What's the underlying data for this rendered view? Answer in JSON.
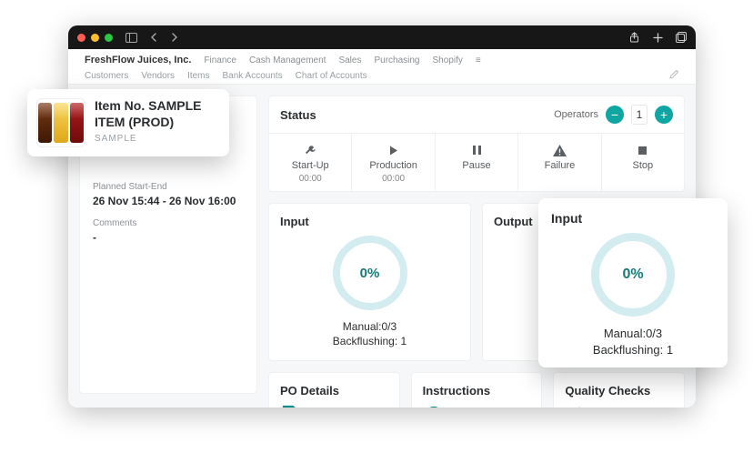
{
  "nav": {
    "brand": "FreshFlow Juices, Inc.",
    "primary": [
      "Finance",
      "Cash Management",
      "Sales",
      "Purchasing",
      "Shopify"
    ],
    "secondary": [
      "Customers",
      "Vendors",
      "Items",
      "Bank Accounts",
      "Chart of Accounts"
    ]
  },
  "item": {
    "title": "Item No. SAMPLE ITEM (PROD)",
    "code": "SAMPLE"
  },
  "plan": {
    "label": "Planned Start-End",
    "value": "26 Nov 15:44 - 26 Nov 16:00",
    "comments_label": "Comments",
    "comments_value": "-"
  },
  "status": {
    "title": "Status",
    "operators_label": "Operators",
    "operators_count": "1",
    "buttons": [
      {
        "label": "Start-Up",
        "time": "00:00"
      },
      {
        "label": "Production",
        "time": "00:00"
      },
      {
        "label": "Pause",
        "time": ""
      },
      {
        "label": "Failure",
        "time": ""
      },
      {
        "label": "Stop",
        "time": ""
      }
    ]
  },
  "input": {
    "title": "Input",
    "pct": "0%",
    "line1": "Manual:0/3",
    "line2": "Backflushing: 1"
  },
  "output": {
    "title": "Output"
  },
  "bottom": {
    "po": "PO Details",
    "instructions": "Instructions",
    "quality": "Quality Checks"
  },
  "zoom_input": {
    "title": "Input",
    "pct": "0%",
    "line1": "Manual:0/3",
    "line2": "Backflushing: 1"
  }
}
